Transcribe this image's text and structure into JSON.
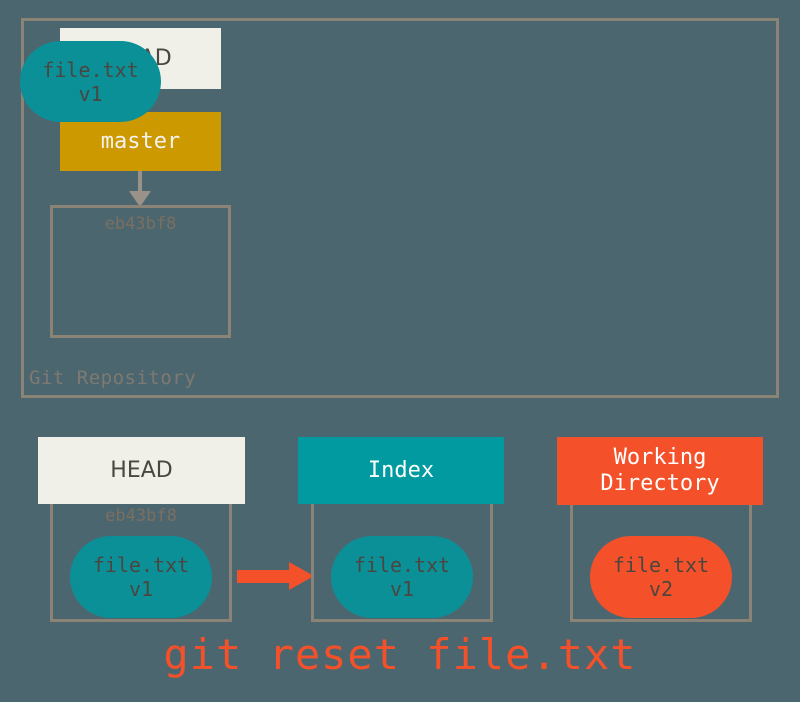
{
  "diagram": {
    "title_command": "git reset file.txt",
    "background_color": "#4b666f",
    "repository": {
      "label": "Git Repository",
      "head": {
        "label": "HEAD",
        "color": "#f0f0e9"
      },
      "branch": {
        "label": "master",
        "color": "#cc9900"
      },
      "commit": {
        "hash": "eb43bf8",
        "blob": {
          "filename": "file.txt",
          "version": "v1",
          "color": "#0b9098"
        }
      }
    },
    "areas": [
      {
        "name": "HEAD",
        "label": "HEAD",
        "header_color": "#f0f0e9",
        "hash": "eb43bf8",
        "blob": {
          "filename": "file.txt",
          "version": "v1",
          "color": "#0b9098"
        }
      },
      {
        "name": "Index",
        "label": "Index",
        "header_color": "#009aa0",
        "hash": "",
        "blob": {
          "filename": "file.txt",
          "version": "v1",
          "color": "#0b9098"
        }
      },
      {
        "name": "Working Directory",
        "label_line1": "Working",
        "label_line2": "Directory",
        "header_color": "#f4512a",
        "hash": "",
        "blob": {
          "filename": "file.txt",
          "version": "v2",
          "color": "#f4512a"
        }
      }
    ],
    "arrows": [
      {
        "from": "HEAD",
        "to": "master",
        "color": "#9a9189",
        "direction": "down"
      },
      {
        "from": "master",
        "to": "eb43bf8",
        "color": "#9a9189",
        "direction": "down"
      },
      {
        "from": "HEAD",
        "to": "Index",
        "color": "#f4512a",
        "direction": "right"
      }
    ]
  }
}
